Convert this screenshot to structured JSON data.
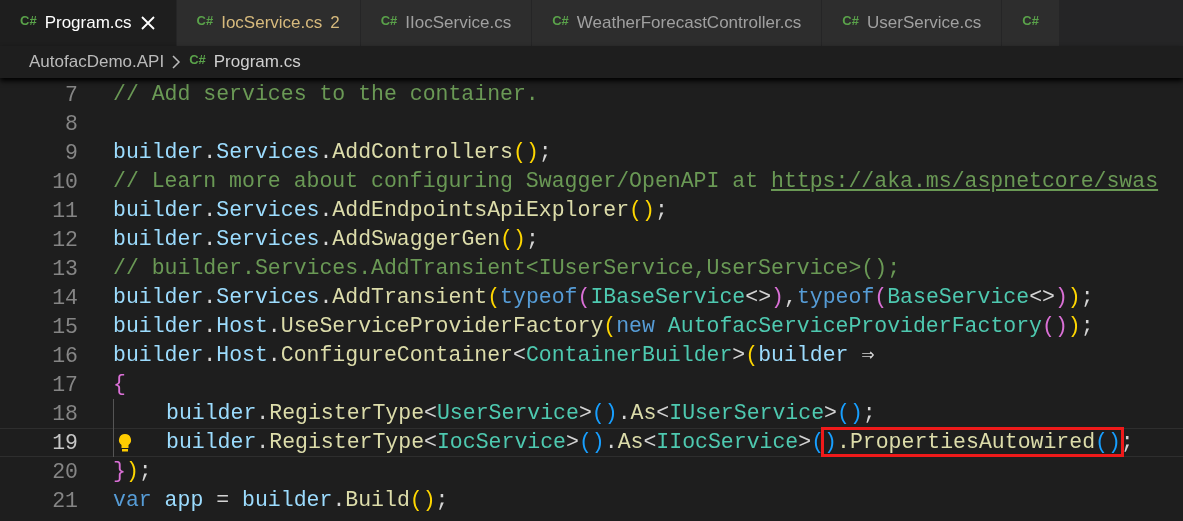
{
  "tabs": [
    {
      "icon": "C#",
      "label": "Program.cs",
      "selected": true,
      "warning": false
    },
    {
      "icon": "C#",
      "label": "IocService.cs",
      "badge": "2",
      "selected": false,
      "warning": true
    },
    {
      "icon": "C#",
      "label": "IIocService.cs",
      "selected": false,
      "warning": false
    },
    {
      "icon": "C#",
      "label": "WeatherForecastController.cs",
      "selected": false,
      "warning": false
    },
    {
      "icon": "C#",
      "label": "UserService.cs",
      "selected": false,
      "warning": false
    },
    {
      "icon": "C#",
      "selected": false
    }
  ],
  "breadcrumb": [
    {
      "kind": "folder",
      "label": "AutofacDemo.API"
    },
    {
      "kind": "file",
      "icon": "C#",
      "label": "Program.cs"
    }
  ],
  "editor": {
    "lines": [
      {
        "number": "7",
        "tokens": [
          {
            "kind": "comment",
            "text": "// Add services to the container."
          }
        ]
      },
      {
        "number": "8"
      },
      {
        "number": "9",
        "tokens": [
          {
            "kind": "var",
            "text": "builder"
          },
          {
            "kind": "punc",
            "text": "."
          },
          {
            "kind": "var",
            "text": "Services"
          },
          {
            "kind": "punc",
            "text": "."
          },
          {
            "kind": "fn",
            "text": "AddControllers"
          },
          {
            "kind": "paren1",
            "text": "()"
          },
          {
            "kind": "punc",
            "text": ";"
          }
        ]
      },
      {
        "number": "10",
        "tokens": [
          {
            "kind": "comment",
            "text": "// Learn more about configuring Swagger/OpenAPI at "
          },
          {
            "kind": "link",
            "text": "https://aka.ms/aspnetcore/swas"
          }
        ]
      },
      {
        "number": "11",
        "tokens": [
          {
            "kind": "var",
            "text": "builder"
          },
          {
            "kind": "punc",
            "text": "."
          },
          {
            "kind": "var",
            "text": "Services"
          },
          {
            "kind": "punc",
            "text": "."
          },
          {
            "kind": "fn",
            "text": "AddEndpointsApiExplorer"
          },
          {
            "kind": "paren1",
            "text": "()"
          },
          {
            "kind": "punc",
            "text": ";"
          }
        ]
      },
      {
        "number": "12",
        "tokens": [
          {
            "kind": "var",
            "text": "builder"
          },
          {
            "kind": "punc",
            "text": "."
          },
          {
            "kind": "var",
            "text": "Services"
          },
          {
            "kind": "punc",
            "text": "."
          },
          {
            "kind": "fn",
            "text": "AddSwaggerGen"
          },
          {
            "kind": "paren1",
            "text": "()"
          },
          {
            "kind": "punc",
            "text": ";"
          }
        ]
      },
      {
        "number": "13",
        "tokens": [
          {
            "kind": "comment",
            "text": "// builder.Services.AddTransient<IUserService,UserService>();"
          }
        ]
      },
      {
        "number": "14",
        "tokens": [
          {
            "kind": "var",
            "text": "builder"
          },
          {
            "kind": "punc",
            "text": "."
          },
          {
            "kind": "var",
            "text": "Services"
          },
          {
            "kind": "punc",
            "text": "."
          },
          {
            "kind": "fn",
            "text": "AddTransient"
          },
          {
            "kind": "paren1",
            "text": "("
          },
          {
            "kind": "kw",
            "text": "typeof"
          },
          {
            "kind": "paren2",
            "text": "("
          },
          {
            "kind": "type",
            "text": "IBaseService"
          },
          {
            "kind": "punc",
            "text": "<>"
          },
          {
            "kind": "paren2",
            "text": ")"
          },
          {
            "kind": "punc",
            "text": ","
          },
          {
            "kind": "kw",
            "text": "typeof"
          },
          {
            "kind": "paren2",
            "text": "("
          },
          {
            "kind": "type",
            "text": "BaseService"
          },
          {
            "kind": "punc",
            "text": "<>"
          },
          {
            "kind": "paren2",
            "text": ")"
          },
          {
            "kind": "paren1",
            "text": ")"
          },
          {
            "kind": "punc",
            "text": ";"
          }
        ]
      },
      {
        "number": "15",
        "tokens": [
          {
            "kind": "var",
            "text": "builder"
          },
          {
            "kind": "punc",
            "text": "."
          },
          {
            "kind": "var",
            "text": "Host"
          },
          {
            "kind": "punc",
            "text": "."
          },
          {
            "kind": "fn",
            "text": "UseServiceProviderFactory"
          },
          {
            "kind": "paren1",
            "text": "("
          },
          {
            "kind": "kw",
            "text": "new "
          },
          {
            "kind": "type",
            "text": "AutofacServiceProviderFactory"
          },
          {
            "kind": "paren2",
            "text": "()"
          },
          {
            "kind": "paren1",
            "text": ")"
          },
          {
            "kind": "punc",
            "text": ";"
          }
        ]
      },
      {
        "number": "16",
        "tokens": [
          {
            "kind": "var",
            "text": "builder"
          },
          {
            "kind": "punc",
            "text": "."
          },
          {
            "kind": "var",
            "text": "Host"
          },
          {
            "kind": "punc",
            "text": "."
          },
          {
            "kind": "fn",
            "text": "ConfigureContainer"
          },
          {
            "kind": "punc",
            "text": "<"
          },
          {
            "kind": "type",
            "text": "ContainerBuilder"
          },
          {
            "kind": "punc",
            "text": ">"
          },
          {
            "kind": "paren1",
            "text": "("
          },
          {
            "kind": "var",
            "text": "builder"
          },
          {
            "kind": "punc",
            "text": " ⇒"
          }
        ]
      },
      {
        "number": "17",
        "tokens": [
          {
            "kind": "paren2",
            "text": "{"
          }
        ]
      },
      {
        "number": "18",
        "indented": true,
        "tokens": [
          {
            "kind": "var",
            "text": "builder"
          },
          {
            "kind": "punc",
            "text": "."
          },
          {
            "kind": "fn",
            "text": "RegisterType"
          },
          {
            "kind": "punc",
            "text": "<"
          },
          {
            "kind": "type",
            "text": "UserService"
          },
          {
            "kind": "punc",
            "text": ">"
          },
          {
            "kind": "paren3",
            "text": "()"
          },
          {
            "kind": "punc",
            "text": "."
          },
          {
            "kind": "fn",
            "text": "As"
          },
          {
            "kind": "punc",
            "text": "<"
          },
          {
            "kind": "type",
            "text": "IUserService"
          },
          {
            "kind": "punc",
            "text": ">"
          },
          {
            "kind": "paren3",
            "text": "()"
          },
          {
            "kind": "punc",
            "text": ";"
          }
        ]
      },
      {
        "number": "19",
        "indented": true,
        "current": true,
        "lightbulb": true,
        "tokens": [
          {
            "kind": "var",
            "text": "builder"
          },
          {
            "kind": "punc",
            "text": "."
          },
          {
            "kind": "fn",
            "text": "RegisterType"
          },
          {
            "kind": "punc",
            "text": "<"
          },
          {
            "kind": "type",
            "text": "IocService"
          },
          {
            "kind": "punc",
            "text": ">"
          },
          {
            "kind": "paren3",
            "text": "()"
          },
          {
            "kind": "punc",
            "text": "."
          },
          {
            "kind": "fn",
            "text": "As"
          },
          {
            "kind": "punc",
            "text": "<"
          },
          {
            "kind": "type",
            "text": "IIocService"
          },
          {
            "kind": "punc",
            "text": ">"
          },
          {
            "kind": "paren3",
            "text": "("
          },
          {
            "kind": "paren3",
            "text": ")",
            "highlighted": true
          },
          {
            "kind": "fn",
            "text": ".PropertiesAutowired",
            "highlighted": true
          },
          {
            "kind": "paren3",
            "text": "()",
            "highlighted": true
          },
          {
            "kind": "punc",
            "text": ";"
          }
        ]
      },
      {
        "number": "20",
        "tokens": [
          {
            "kind": "paren2",
            "text": "}"
          },
          {
            "kind": "paren1",
            "text": ")"
          },
          {
            "kind": "punc",
            "text": ";"
          }
        ]
      },
      {
        "number": "21",
        "tokens": [
          {
            "kind": "kw",
            "text": "var "
          },
          {
            "kind": "var",
            "text": "app"
          },
          {
            "kind": "punc",
            "text": " = "
          },
          {
            "kind": "var",
            "text": "builder"
          },
          {
            "kind": "punc",
            "text": "."
          },
          {
            "kind": "fn",
            "text": "Build"
          },
          {
            "kind": "paren1",
            "text": "()"
          },
          {
            "kind": "punc",
            "text": ";"
          }
        ]
      }
    ]
  }
}
